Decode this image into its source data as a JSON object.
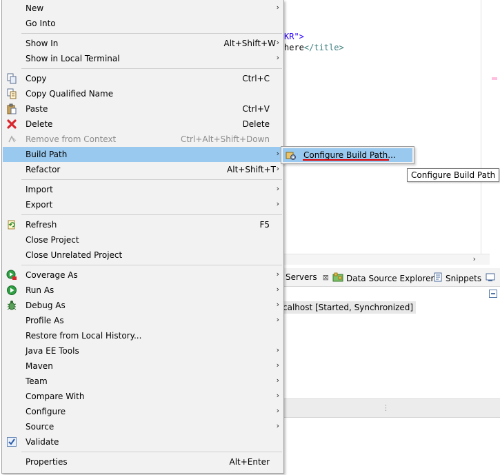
{
  "editor": {
    "code_line_1": "KR\">",
    "code_line_2_text": "here",
    "code_line_2_tag": "</title>"
  },
  "views": {
    "tabs": [
      {
        "label": "Servers"
      },
      {
        "label": "Data Source Explorer"
      },
      {
        "label": "Snippets"
      }
    ],
    "server_entry": "calhost  [Started, Synchronized]"
  },
  "menu": {
    "items": [
      {
        "label": "New",
        "accel": "",
        "submenu": true,
        "icon": ""
      },
      {
        "label": "Go Into",
        "accel": "",
        "submenu": false,
        "icon": ""
      },
      {
        "label": "Show In",
        "accel": "Alt+Shift+W",
        "submenu": true,
        "icon": ""
      },
      {
        "label": "Show in Local Terminal",
        "accel": "",
        "submenu": true,
        "icon": ""
      },
      {
        "label": "Copy",
        "accel": "Ctrl+C",
        "submenu": false,
        "icon": "copy-icon"
      },
      {
        "label": "Copy Qualified Name",
        "accel": "",
        "submenu": false,
        "icon": "copy-qualified-name-icon"
      },
      {
        "label": "Paste",
        "accel": "Ctrl+V",
        "submenu": false,
        "icon": "paste-icon"
      },
      {
        "label": "Delete",
        "accel": "Delete",
        "submenu": false,
        "icon": "delete-icon"
      },
      {
        "label": "Remove from Context",
        "accel": "Ctrl+Alt+Shift+Down",
        "submenu": false,
        "icon": "remove-from-context-icon",
        "disabled": true
      },
      {
        "label": "Build Path",
        "accel": "",
        "submenu": true,
        "icon": "",
        "highlighted": true
      },
      {
        "label": "Refactor",
        "accel": "Alt+Shift+T",
        "submenu": true,
        "icon": ""
      },
      {
        "label": "Import",
        "accel": "",
        "submenu": true,
        "icon": ""
      },
      {
        "label": "Export",
        "accel": "",
        "submenu": true,
        "icon": ""
      },
      {
        "label": "Refresh",
        "accel": "F5",
        "submenu": false,
        "icon": "refresh-icon"
      },
      {
        "label": "Close Project",
        "accel": "",
        "submenu": false,
        "icon": ""
      },
      {
        "label": "Close Unrelated Project",
        "accel": "",
        "submenu": false,
        "icon": ""
      },
      {
        "label": "Coverage As",
        "accel": "",
        "submenu": true,
        "icon": "coverage-icon"
      },
      {
        "label": "Run As",
        "accel": "",
        "submenu": true,
        "icon": "run-icon"
      },
      {
        "label": "Debug As",
        "accel": "",
        "submenu": true,
        "icon": "debug-icon"
      },
      {
        "label": "Profile As",
        "accel": "",
        "submenu": true,
        "icon": ""
      },
      {
        "label": "Restore from Local History...",
        "accel": "",
        "submenu": false,
        "icon": ""
      },
      {
        "label": "Java EE Tools",
        "accel": "",
        "submenu": true,
        "icon": ""
      },
      {
        "label": "Maven",
        "accel": "",
        "submenu": true,
        "icon": ""
      },
      {
        "label": "Team",
        "accel": "",
        "submenu": true,
        "icon": ""
      },
      {
        "label": "Compare With",
        "accel": "",
        "submenu": true,
        "icon": ""
      },
      {
        "label": "Configure",
        "accel": "",
        "submenu": true,
        "icon": ""
      },
      {
        "label": "Source",
        "accel": "",
        "submenu": true,
        "icon": ""
      },
      {
        "label": "Validate",
        "accel": "",
        "submenu": false,
        "icon": "checkmark-icon"
      },
      {
        "label": "Properties",
        "accel": "Alt+Enter",
        "submenu": false,
        "icon": ""
      }
    ]
  },
  "submenu": {
    "label": "Configure Build Path...",
    "icon": "configure-build-path-icon"
  },
  "tooltip": {
    "text": "Configure Build Path"
  },
  "colors": {
    "highlight": "#99c9ef",
    "menu_bg": "#f2f2f2",
    "underline": "#e00000"
  }
}
